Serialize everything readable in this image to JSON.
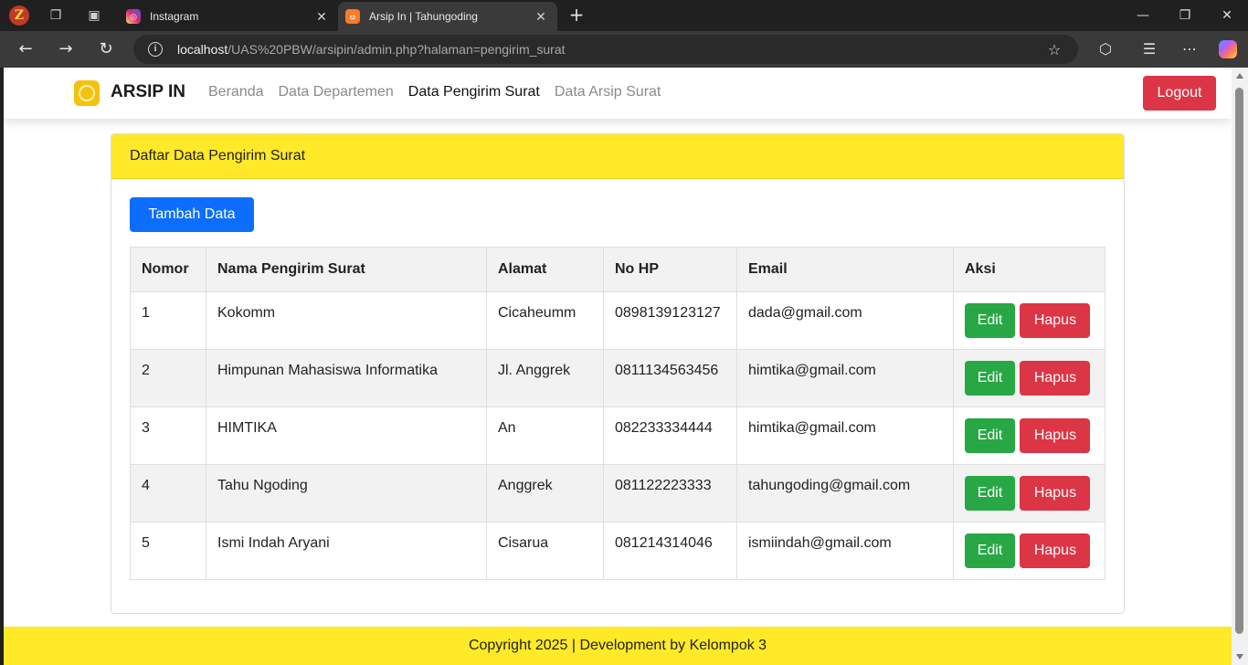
{
  "browser": {
    "tabs": [
      {
        "title": "Instagram",
        "favicon": "instagram-icon",
        "active": false
      },
      {
        "title": "Arsip In | Tahungoding",
        "favicon": "xampp-icon",
        "active": true
      }
    ],
    "url_host": "localhost",
    "url_path": "/UAS%20PBW/arsipin/admin.php?halaman=pengirim_surat"
  },
  "navbar": {
    "brand": "ARSIP IN",
    "menu": [
      {
        "label": "Beranda",
        "active": false
      },
      {
        "label": "Data Departemen",
        "active": false
      },
      {
        "label": "Data Pengirim Surat",
        "active": true
      },
      {
        "label": "Data Arsip Surat",
        "active": false
      }
    ],
    "logout_label": "Logout"
  },
  "card": {
    "header": "Daftar Data Pengirim Surat",
    "add_button": "Tambah Data"
  },
  "table": {
    "columns": [
      "Nomor",
      "Nama Pengirim Surat",
      "Alamat",
      "No HP",
      "Email",
      "Aksi"
    ],
    "rows": [
      {
        "nomor": "1",
        "nama": "Kokomm",
        "alamat": "Cicaheumm",
        "hp": "0898139123127",
        "email": "dada@gmail.com"
      },
      {
        "nomor": "2",
        "nama": "Himpunan Mahasiswa Informatika",
        "alamat": "Jl. Anggrek",
        "hp": "0811134563456",
        "email": "himtika@gmail.com"
      },
      {
        "nomor": "3",
        "nama": "HIMTIKA",
        "alamat": "An",
        "hp": "082233334444",
        "email": "himtika@gmail.com"
      },
      {
        "nomor": "4",
        "nama": "Tahu Ngoding",
        "alamat": "Anggrek",
        "hp": "081122223333",
        "email": "tahungoding@gmail.com"
      },
      {
        "nomor": "5",
        "nama": "Ismi Indah Aryani",
        "alamat": "Cisarua",
        "hp": "081214314046",
        "email": "ismiindah@gmail.com"
      }
    ],
    "edit_label": "Edit",
    "delete_label": "Hapus"
  },
  "footer": {
    "text": "Copyright 2025 | Development by Kelompok 3"
  },
  "colors": {
    "accent_yellow": "#ffe928",
    "primary_blue": "#0d6efd",
    "danger_red": "#dc3545",
    "success_green": "#28a745"
  }
}
